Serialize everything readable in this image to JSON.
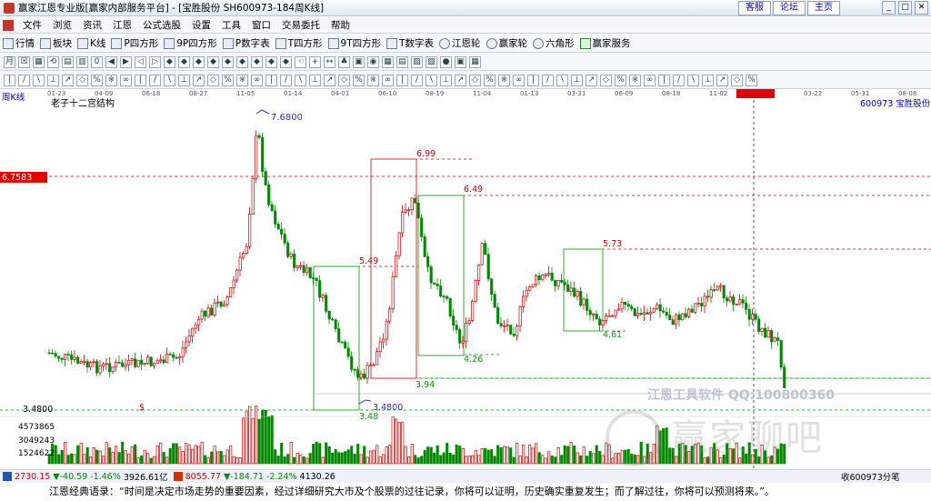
{
  "window": {
    "title": "赢家江恩专业版[赢家内部服务平台] - [宝胜股份  SH600973-184周K线]",
    "links": [
      "客服",
      "论坛",
      "主页"
    ]
  },
  "menu": [
    "文件",
    "浏览",
    "资讯",
    "江恩",
    "公式选股",
    "设置",
    "工具",
    "窗口",
    "交易委托",
    "帮助"
  ],
  "toolbar1": [
    "行情",
    "板块",
    "K线",
    "P四方形",
    "9P四方形",
    "P数字表",
    "T四方形",
    "9T四方形",
    "T数字表",
    "江恩轮",
    "赢家轮",
    "六角形",
    "赢家服务"
  ],
  "chart": {
    "period_label": "周K线",
    "study_label": "老子十二宫结构",
    "code_label": "600973  宝胜股份",
    "time_labels": [
      "01-23",
      "04-09",
      "06-18",
      "08-27",
      "11-05",
      "01-14",
      "04-01",
      "06-10",
      "08-19",
      "11-04",
      "01-13",
      "03-31",
      "06-09",
      "08-18",
      "11-02",
      "2023-12-22",
      "03-22",
      "05-31",
      "08-08"
    ],
    "price_tag": "6.7583",
    "price_low_label": "3.4800",
    "volume_labels": [
      "4573865",
      "3049243",
      "1524622"
    ],
    "annotations": [
      "7.6800",
      "6.99",
      "6.49",
      "5.73",
      "5.49",
      "4.61",
      "4.26",
      "3.94",
      "3.48",
      "3.4800"
    ],
    "marker": "$"
  },
  "watermark": {
    "top": "江恩工具软件  QQ:100800360",
    "main": "赢家聊吧"
  },
  "status": {
    "sh_index": "2730.15",
    "sh_change": "▼-40.59",
    "sh_pct": "-1.46%",
    "sh_amount": "3926.61亿",
    "sz_index": "8055.77",
    "sz_change": "▼-184.71",
    "sz_pct": "-2.24%",
    "sz_amount": "4130.26",
    "right": "收600973分笔"
  },
  "quote": "江恩经典语录：“时间是决定市场走势的重要因素，经过详细研究大市及个股票的过往记录，你将可以证明，历史确实重复发生；而了解过往，你将可以预测将来。”。"
}
